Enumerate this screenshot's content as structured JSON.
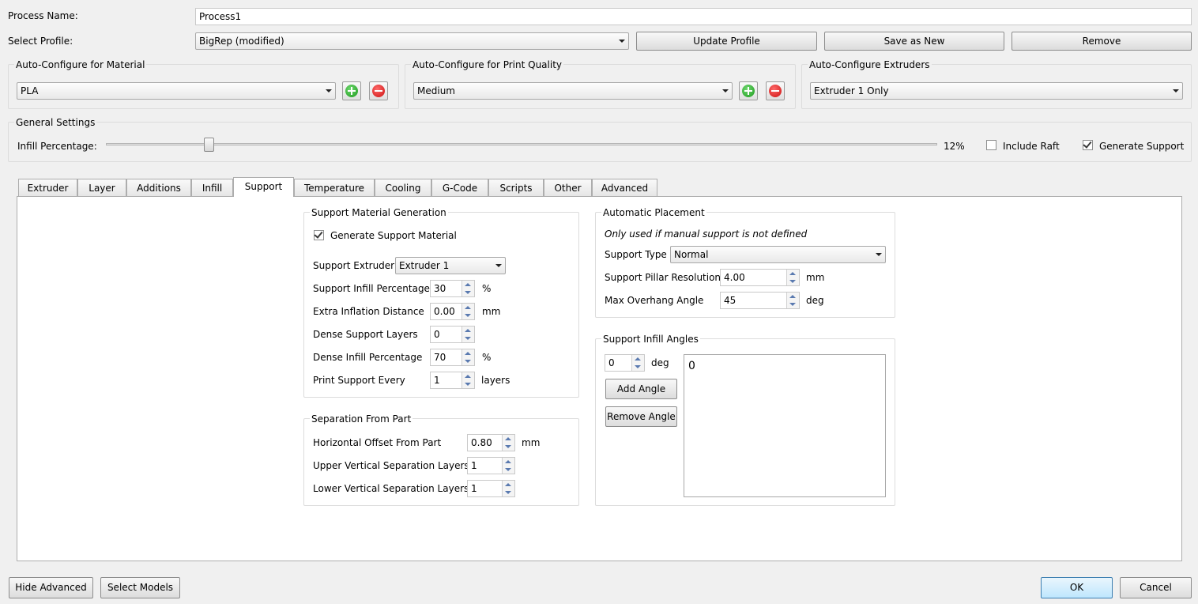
{
  "process": {
    "name_label": "Process Name:",
    "name_value": "Process1"
  },
  "profile": {
    "label": "Select Profile:",
    "selected": "BigRep (modified)",
    "update_label": "Update Profile",
    "save_new_label": "Save as New",
    "remove_label": "Remove"
  },
  "auto_material": {
    "title": "Auto-Configure for Material",
    "selected": "PLA"
  },
  "auto_quality": {
    "title": "Auto-Configure for Print Quality",
    "selected": "Medium"
  },
  "auto_extruders": {
    "title": "Auto-Configure Extruders",
    "selected": "Extruder 1 Only"
  },
  "general": {
    "title": "General Settings",
    "infill_label": "Infill Percentage:",
    "infill_value_text": "12%",
    "infill_fraction": 0.12,
    "include_raft_label": "Include Raft",
    "include_raft_checked": false,
    "generate_support_label": "Generate Support",
    "generate_support_checked": true
  },
  "tabs": [
    {
      "label": "Extruder"
    },
    {
      "label": "Layer"
    },
    {
      "label": "Additions"
    },
    {
      "label": "Infill"
    },
    {
      "label": "Support",
      "active": true
    },
    {
      "label": "Temperature"
    },
    {
      "label": "Cooling"
    },
    {
      "label": "G-Code"
    },
    {
      "label": "Scripts"
    },
    {
      "label": "Other"
    },
    {
      "label": "Advanced"
    }
  ],
  "support_gen": {
    "title": "Support Material Generation",
    "generate_label": "Generate Support Material",
    "generate_checked": true,
    "extruder_label": "Support Extruder",
    "extruder_value": "Extruder 1",
    "infill_pct_label": "Support Infill Percentage",
    "infill_pct_value": "30",
    "infill_pct_unit": "%",
    "inflation_label": "Extra Inflation Distance",
    "inflation_value": "0.00",
    "inflation_unit": "mm",
    "dense_layers_label": "Dense Support Layers",
    "dense_layers_value": "0",
    "dense_infill_label": "Dense Infill Percentage",
    "dense_infill_value": "70",
    "dense_infill_unit": "%",
    "every_label": "Print Support Every",
    "every_value": "1",
    "every_unit": "layers"
  },
  "separation": {
    "title": "Separation From Part",
    "horizontal_label": "Horizontal Offset From Part",
    "horizontal_value": "0.80",
    "horizontal_unit": "mm",
    "upper_label": "Upper Vertical Separation Layers",
    "upper_value": "1",
    "lower_label": "Lower Vertical Separation Layers",
    "lower_value": "1"
  },
  "auto_placement": {
    "title": "Automatic Placement",
    "note": "Only used if manual support is not defined",
    "type_label": "Support Type",
    "type_value": "Normal",
    "pillar_label": "Support Pillar Resolution",
    "pillar_value": "4.00",
    "pillar_unit": "mm",
    "overhang_label": "Max Overhang Angle",
    "overhang_value": "45",
    "overhang_unit": "deg"
  },
  "angles": {
    "title": "Support Infill Angles",
    "angle_value": "0",
    "angle_unit": "deg",
    "add_label": "Add Angle",
    "remove_label": "Remove Angle",
    "list": [
      "0"
    ]
  },
  "footer": {
    "hide_advanced_label": "Hide Advanced",
    "select_models_label": "Select Models",
    "ok_label": "OK",
    "cancel_label": "Cancel"
  }
}
